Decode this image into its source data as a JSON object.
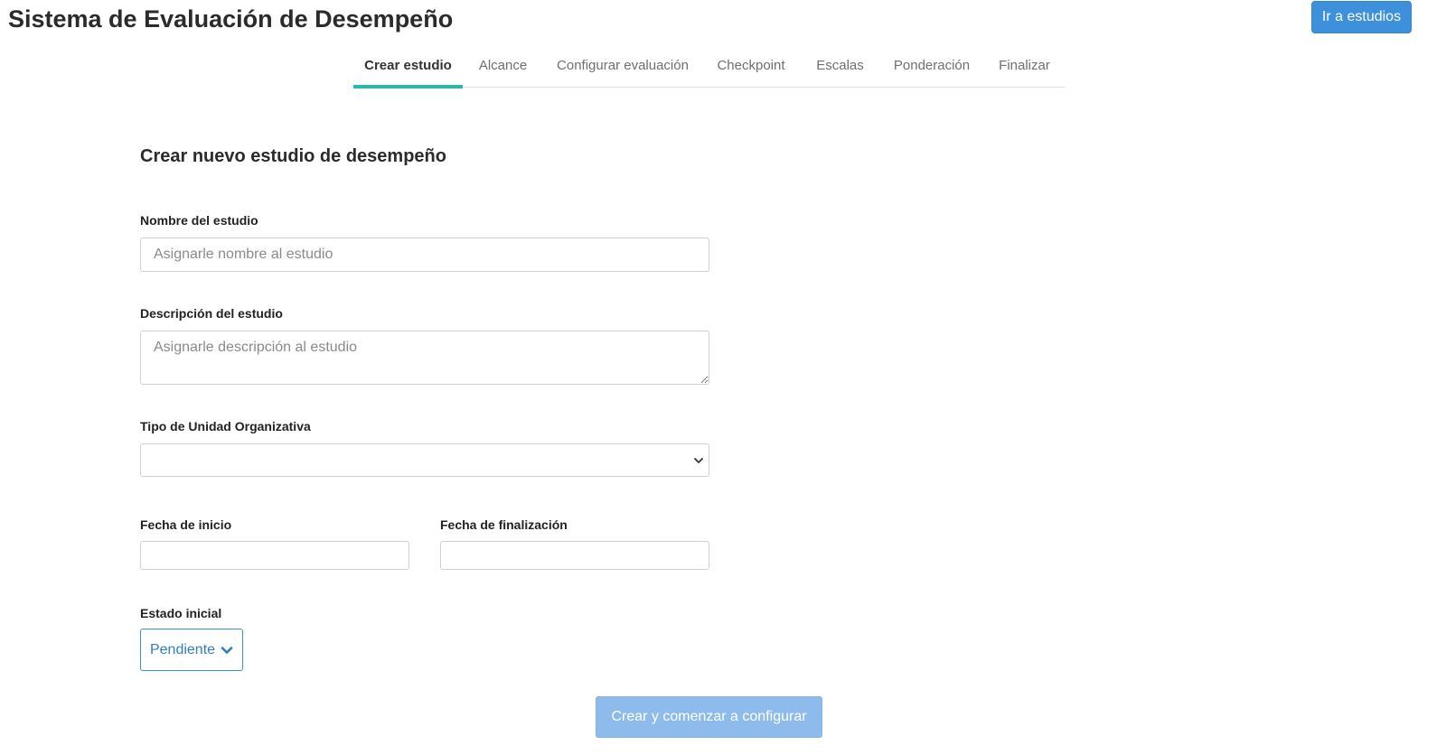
{
  "header": {
    "title": "Sistema de Evaluación de Desempeño",
    "go_studies_label": "Ir a estudios"
  },
  "tabs": [
    {
      "label": "Crear estudio",
      "active": true
    },
    {
      "label": "Alcance",
      "active": false
    },
    {
      "label": "Configurar evaluación",
      "active": false
    },
    {
      "label": "Checkpoint",
      "active": false
    },
    {
      "label": "Escalas",
      "active": false
    },
    {
      "label": "Ponderación",
      "active": false
    },
    {
      "label": "Finalizar",
      "active": false
    }
  ],
  "form": {
    "title": "Crear nuevo estudio de desempeño",
    "study_name": {
      "label": "Nombre del estudio",
      "placeholder": "Asignarle nombre al estudio",
      "value": ""
    },
    "study_description": {
      "label": "Descripción del estudio",
      "placeholder": "Asignarle descripción al estudio",
      "value": ""
    },
    "org_unit_type": {
      "label": "Tipo de Unidad Organizativa",
      "selected": ""
    },
    "start_date": {
      "label": "Fecha de inicio",
      "value": ""
    },
    "end_date": {
      "label": "Fecha de finalización",
      "value": ""
    },
    "initial_state": {
      "label": "Estado inicial",
      "selected": "Pendiente"
    },
    "submit_label": "Crear y comenzar a configurar"
  },
  "colors": {
    "primary_button": "#3d90dc",
    "submit_button_disabled": "#8dbcec",
    "active_tab_underline": "#28b8b0",
    "state_button_text": "#2e7fc4"
  },
  "icons": {
    "select_chevron": "chevron-down-icon",
    "state_chevron": "chevron-down-icon"
  }
}
